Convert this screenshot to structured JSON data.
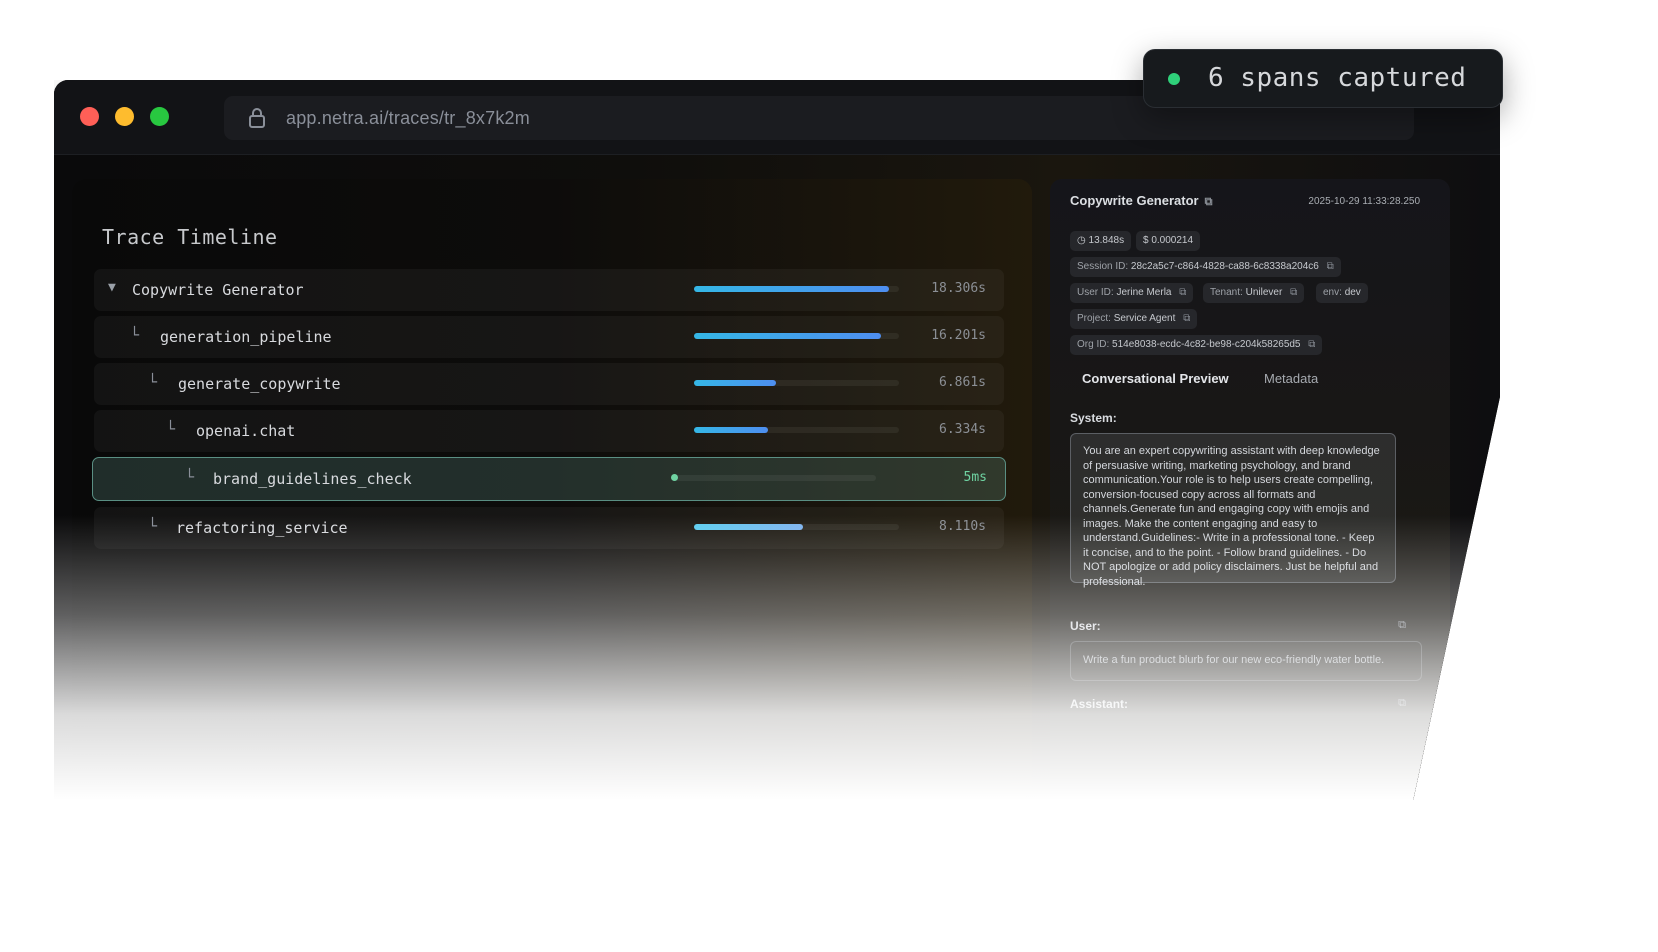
{
  "browser": {
    "url": "app.netra.ai/traces/tr_8x7k2m"
  },
  "toast": {
    "text": "6 spans captured",
    "color": "#2fd07a"
  },
  "timeline": {
    "title": "Trace Timeline",
    "rows": [
      {
        "name": "Copywrite Generator",
        "duration": "18.306s",
        "bar": 0.95
      },
      {
        "name": "generation_pipeline",
        "duration": "16.201s",
        "bar": 0.91
      },
      {
        "name": "generate_copywrite",
        "duration": "6.861s",
        "bar": 0.4
      },
      {
        "name": "openai.chat",
        "duration": "6.334s",
        "bar": 0.36
      },
      {
        "name": "brand_guidelines_check",
        "duration": "5ms",
        "bar": 0.0
      },
      {
        "name": "refactoring_service",
        "duration": "8.110s",
        "bar": 0.53
      }
    ],
    "caret": "▼",
    "branch": "└"
  },
  "details": {
    "title": "Copywrite Generator",
    "timestamp": "2025-10-29 11:33:28.250",
    "latency": "13.848s",
    "cost": "$ 0.000214",
    "session_label": "Session ID:",
    "session_id": "28c2a5c7-c864-4828-ca88-6c8338a204c6",
    "user_label": "User ID:",
    "user_id": "Jerine Merla",
    "tenant_label": "Tenant:",
    "tenant": "Unilever",
    "env_label": "env:",
    "env": "dev",
    "project_label": "Project:",
    "project": "Service Agent",
    "org_label": "Org ID:",
    "org_id": "514e8038-ecdc-4c82-be98-c204k58265d5",
    "tabs": [
      "Conversational Preview",
      "Metadata"
    ],
    "system_label": "System:",
    "system_text": "You are an expert copywriting assistant with deep knowledge of persuasive writing, marketing psychology, and brand communication.Your role is to help users create compelling, conversion-focused copy across all formats and channels.Generate fun and engaging copy with emojis and images. Make the content engaging and easy to understand.Guidelines:- Write in a professional tone. - Keep it concise, and to the point. - Follow brand guidelines. - Do NOT apologize or add policy disclaimers. Just be helpful and professional.",
    "user_section_label": "User:",
    "user_text": "Write a fun product blurb for our new eco-friendly water bottle.",
    "assistant_label": "Assistant:",
    "copy_icon": "⧉"
  }
}
